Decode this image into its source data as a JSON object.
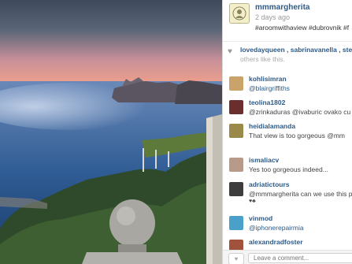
{
  "post": {
    "owner": "mmmargherita",
    "time": "2 days ago",
    "caption": "#aroomwithaview #dubrovnik #f"
  },
  "likes": {
    "names": "lovedayqueen , sabrinavanella , ste",
    "suffix": "others like this."
  },
  "comments": [
    {
      "user": "kohlisimran",
      "text": "@blairgriffiths",
      "extra": "",
      "avatar_color": "#c9a36a"
    },
    {
      "user": "teolina1802",
      "text": "@zrinkaduras @ivaburic ovako cu",
      "extra": "",
      "avatar_color": "#6b2e2e"
    },
    {
      "user": "heidialamanda",
      "text": "That view is too gorgeous @mm",
      "extra": "",
      "avatar_color": "#9a8a4a"
    },
    {
      "user": "ismaliacv",
      "text": "Yes too gorgeous indeed...",
      "extra": "",
      "avatar_color": "#b89a8a"
    },
    {
      "user": "adriatictours",
      "text": "@mmmargherita can we use this p",
      "extra": "♥♣",
      "avatar_color": "#3d3d3d"
    },
    {
      "user": "vinmod",
      "text": "@iphonerepairmia",
      "extra": "",
      "avatar_color": "#4aa0c8"
    },
    {
      "user": "alexandradfoster",
      "text": "",
      "extra": "",
      "avatar_color": "#a0523d"
    }
  ],
  "comment_box": {
    "placeholder": "Leave a comment..."
  },
  "icons": [
    "heart-icon",
    "owner-avatar",
    "like-button-icon"
  ]
}
